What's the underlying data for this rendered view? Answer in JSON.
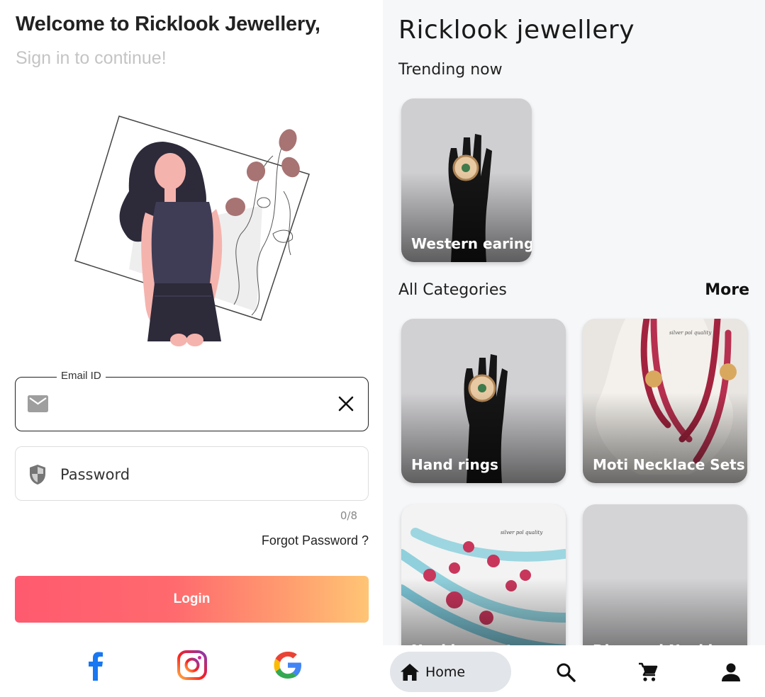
{
  "login": {
    "welcome": "Welcome to Ricklook Jewellery,",
    "subtitle": "Sign in to continue!",
    "email_label": "Email ID",
    "email_value": "",
    "password_placeholder": "Password",
    "password_counter": "0/8",
    "forgot_password": "Forgot Password ?",
    "login_button": "Login",
    "social": [
      "facebook-icon",
      "instagram-icon",
      "google-icon"
    ],
    "colors": {
      "login_gradient_start": "#ff5a6f",
      "login_gradient_end": "#ffc575",
      "facebook": "#1877f2"
    }
  },
  "store": {
    "title": "Ricklook jewellery",
    "trending_heading": "Trending now",
    "trending": [
      {
        "label": "Western earing"
      }
    ],
    "categories_heading": "All Categories",
    "more_label": "More",
    "categories": [
      {
        "label": "Hand rings"
      },
      {
        "label": "Moti Necklace Sets"
      },
      {
        "label": "Necklace sets"
      },
      {
        "label": "Diamond Necklace"
      }
    ]
  },
  "nav": {
    "home_label": "Home",
    "items": [
      "home-icon",
      "search-icon",
      "cart-icon",
      "profile-icon"
    ]
  }
}
